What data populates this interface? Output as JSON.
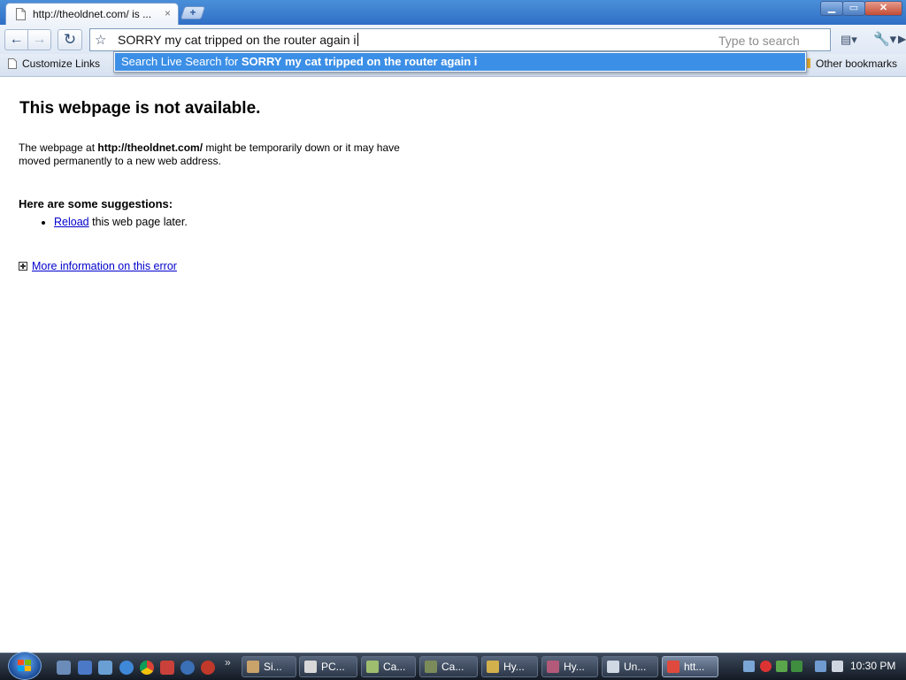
{
  "browser": {
    "tab": {
      "title": "http://theoldnet.com/ is ...",
      "close_icon": "×"
    },
    "new_tab_icon": "+",
    "window_controls": {
      "minimize": "▁",
      "maximize": "▭",
      "close": "✕"
    },
    "toolbar": {
      "back_icon": "←",
      "forward_icon": "→",
      "reload_icon": "↻",
      "star_icon": "☆",
      "omnibox_value": "SORRY my cat tripped on the router again i",
      "omnibox_hint": "Type to search",
      "go_icon": "▶",
      "page_menu_icon": "▤▾",
      "wrench_icon": "🔧▾"
    },
    "bookmarks": {
      "customize_links": "Customize Links",
      "other_bookmarks": "Other bookmarks"
    },
    "dropdown": {
      "prefix": "Search Live Search for ",
      "query": "SORRY my cat tripped on the router again i"
    }
  },
  "page": {
    "title": "This webpage is not available.",
    "desc_pre": "The webpage at ",
    "desc_url": "http://theoldnet.com/",
    "desc_post": " might be temporarily down or it may have moved permanently to a new web address.",
    "suggestions_heading": "Here are some suggestions:",
    "suggestion_link": "Reload",
    "suggestion_rest": " this web page later.",
    "more_info": "More information on this error"
  },
  "taskbar": {
    "quick_launch_more": "»",
    "tasks": [
      {
        "label": "Si...",
        "color": "#c9a36a"
      },
      {
        "label": "PC...",
        "color": "#d8d8d8"
      },
      {
        "label": "Ca...",
        "color": "#9fbf6e"
      },
      {
        "label": "Ca...",
        "color": "#7c8b5a"
      },
      {
        "label": "Hy...",
        "color": "#d2b04c"
      },
      {
        "label": "Hy...",
        "color": "#b35a7a"
      },
      {
        "label": "Un...",
        "color": "#cfd8e3"
      },
      {
        "label": "htt...",
        "color": "#e0493d"
      }
    ],
    "clock": "10:30 PM"
  }
}
